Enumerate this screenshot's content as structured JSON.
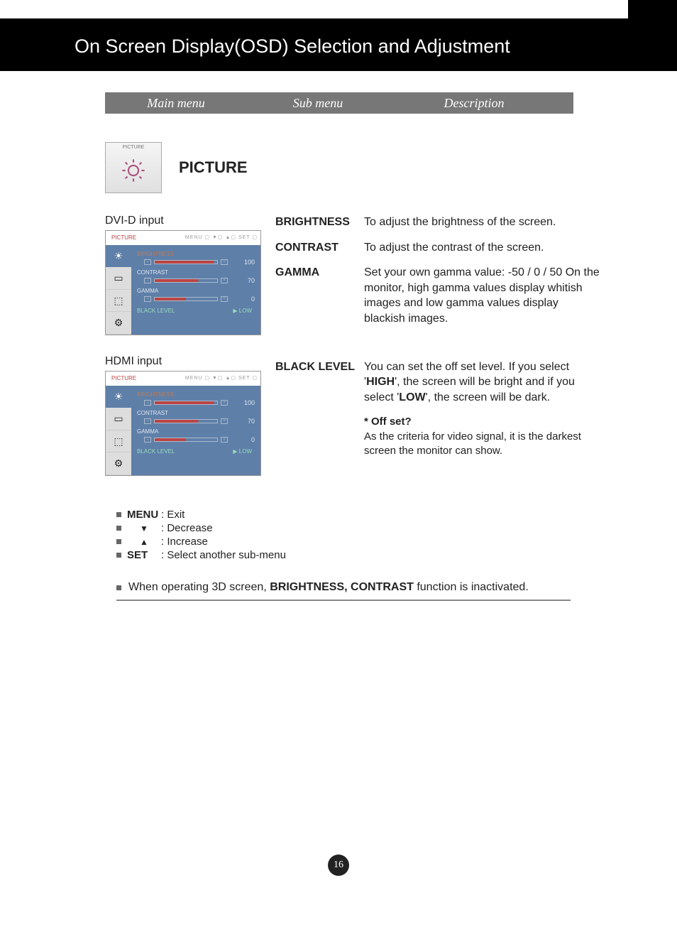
{
  "header": {
    "title": "On Screen Display(OSD) Selection and Adjustment"
  },
  "table_header": {
    "main": "Main menu",
    "sub": "Sub menu",
    "desc": "Description"
  },
  "picture": {
    "icon_label": "PICTURE",
    "title": "PICTURE"
  },
  "inputs": {
    "dvi": {
      "label": "DVI-D input"
    },
    "hdmi": {
      "label": "HDMI input"
    }
  },
  "osd": {
    "header_title": "PICTURE",
    "header_btns": "MENU ▢  ▼▢  ▲▢  SET ▢",
    "rows": {
      "brightness": {
        "label": "BRIGHTNESS",
        "value": "100",
        "fill": "95%"
      },
      "contrast": {
        "label": "CONTRAST",
        "value": "70",
        "fill": "70%"
      },
      "gamma": {
        "label": "GAMMA",
        "value": "0",
        "fill": "50%"
      },
      "blacklevel": {
        "label": "BLACK LEVEL",
        "value": "▶ LOW"
      }
    }
  },
  "definitions": {
    "brightness": {
      "term": "BRIGHTNESS",
      "desc": "To adjust the brightness of the screen."
    },
    "contrast": {
      "term": "CONTRAST",
      "desc": "To adjust the contrast of the screen."
    },
    "gamma": {
      "term": "GAMMA",
      "desc": "Set your own gamma value: -50 / 0 / 50 On the monitor, high gamma values display whitish images and low gamma values display blackish images."
    },
    "blacklevel": {
      "term": "BLACK LEVEL",
      "desc_pre": "You can set the off set level. If you select '",
      "high": "HIGH",
      "desc_mid": "', the screen will be bright and if you select '",
      "low": "LOW",
      "desc_post": "', the screen will be dark.",
      "note_q": "* Off set?",
      "note_a": "As the criteria for video signal, it is the darkest screen the monitor can show."
    }
  },
  "legend": {
    "menu": {
      "label": "MENU",
      "desc": ": Exit"
    },
    "down": {
      "symbol": "▼",
      "desc": ": Decrease"
    },
    "up": {
      "symbol": "▲",
      "desc": ": Increase"
    },
    "set": {
      "label": "SET",
      "desc": ": Select another sub-menu"
    }
  },
  "foot_note": {
    "pre": "When operating 3D screen, ",
    "bold": "BRIGHTNESS, CONTRAST",
    "post": " function is inactivated."
  },
  "page_number": "16"
}
